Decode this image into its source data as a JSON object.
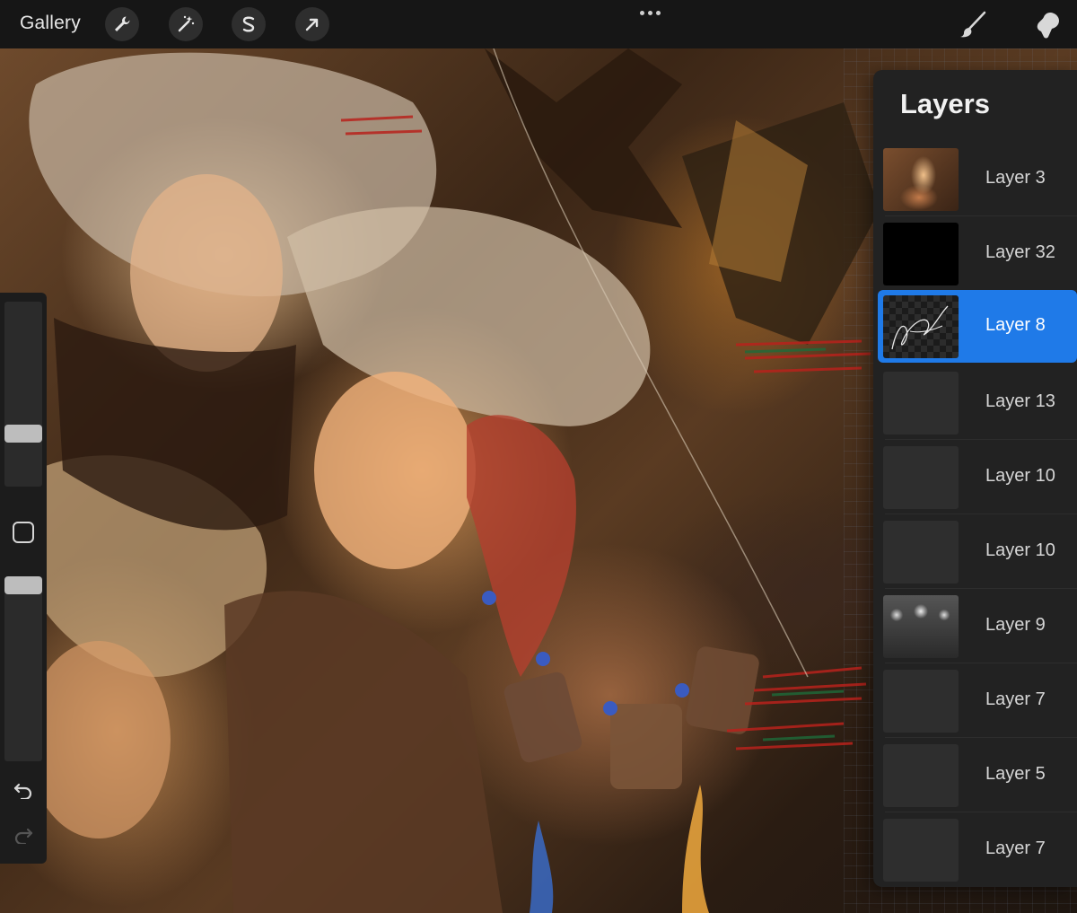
{
  "toolbar": {
    "gallery_label": "Gallery",
    "left_tools": [
      {
        "name": "actions",
        "icon": "wrench-icon"
      },
      {
        "name": "adjustments",
        "icon": "magic-wand-icon"
      },
      {
        "name": "selection",
        "icon": "selection-s-icon"
      },
      {
        "name": "transform",
        "icon": "arrow-cursor-icon"
      }
    ],
    "more_icon": "ellipsis-icon",
    "right_tools": [
      {
        "name": "brush",
        "icon": "brush-icon"
      },
      {
        "name": "smudge",
        "icon": "smudge-finger-icon"
      }
    ]
  },
  "sidebar": {
    "brush_size_level": 0.29,
    "opacity_level": 0.0,
    "modify_icon": "square-icon",
    "undo_icon": "undo-arrow-icon",
    "redo_icon": "redo-arrow-icon"
  },
  "layers": {
    "title": "Layers",
    "items": [
      {
        "name": "Layer 3",
        "thumb": "art",
        "active": false
      },
      {
        "name": "Layer 32",
        "thumb": "black",
        "active": false
      },
      {
        "name": "Layer 8",
        "thumb": "checker-signature",
        "active": true
      },
      {
        "name": "Layer 13",
        "thumb": "dark",
        "active": false
      },
      {
        "name": "Layer 10",
        "thumb": "dark",
        "active": false
      },
      {
        "name": "Layer 10",
        "thumb": "dark",
        "active": false
      },
      {
        "name": "Layer 9",
        "thumb": "lights",
        "active": false
      },
      {
        "name": "Layer 7",
        "thumb": "dark",
        "active": false
      },
      {
        "name": "Layer 5",
        "thumb": "dark",
        "active": false
      },
      {
        "name": "Layer 7",
        "thumb": "dark",
        "active": false
      }
    ]
  },
  "colors": {
    "accent": "#1f7ae8",
    "panel": "#222222",
    "toolbar": "#161616"
  }
}
